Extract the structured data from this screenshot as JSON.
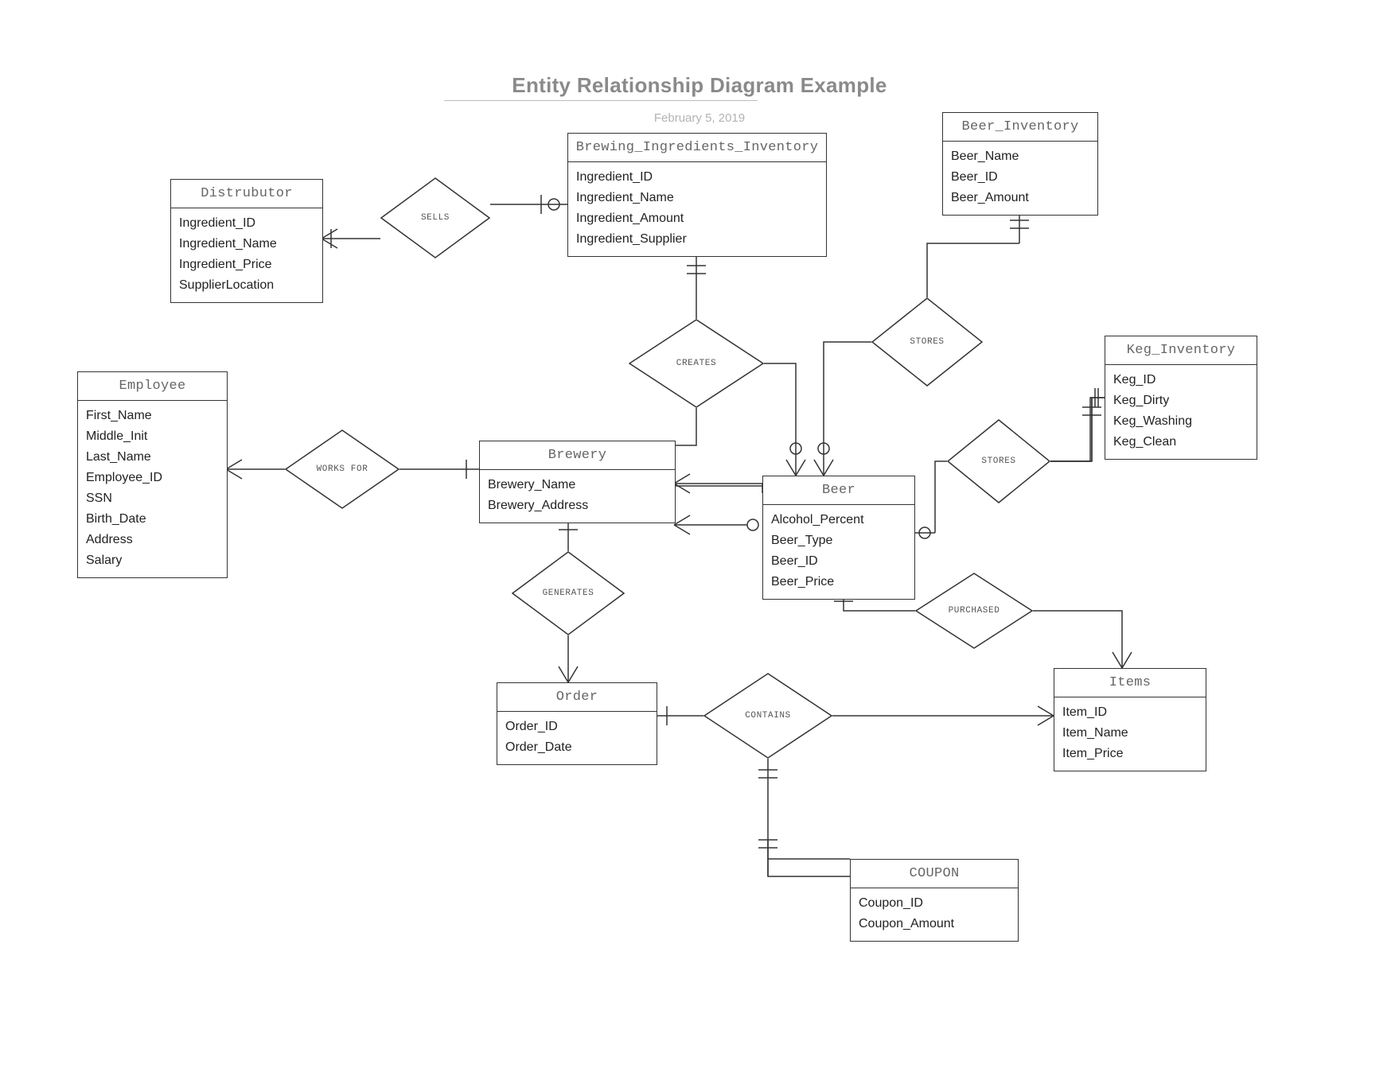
{
  "title": "Entity Relationship Diagram Example",
  "subtitle": "February 5, 2019",
  "entities": {
    "distributor": {
      "name": "Distrubutor",
      "attrs": [
        "Ingredient_ID",
        "Ingredient_Name",
        "Ingredient_Price",
        "SupplierLocation"
      ]
    },
    "brewing_inv": {
      "name": "Brewing_Ingredients_Inventory",
      "attrs": [
        "Ingredient_ID",
        "Ingredient_Name",
        "Ingredient_Amount",
        "Ingredient_Supplier"
      ]
    },
    "beer_inv": {
      "name": "Beer_Inventory",
      "attrs": [
        "Beer_Name",
        "Beer_ID",
        "Beer_Amount"
      ]
    },
    "employee": {
      "name": "Employee",
      "attrs": [
        "First_Name",
        "Middle_Init",
        "Last_Name",
        "Employee_ID",
        "SSN",
        "Birth_Date",
        "Address",
        "Salary"
      ]
    },
    "brewery": {
      "name": "Brewery",
      "attrs": [
        "Brewery_Name",
        "Brewery_Address"
      ]
    },
    "keg_inv": {
      "name": "Keg_Inventory",
      "attrs": [
        "Keg_ID",
        "Keg_Dirty",
        "Keg_Washing",
        "Keg_Clean"
      ]
    },
    "beer": {
      "name": "Beer",
      "attrs": [
        "Alcohol_Percent",
        "Beer_Type",
        "Beer_ID",
        "Beer_Price"
      ]
    },
    "order": {
      "name": "Order",
      "attrs": [
        "Order_ID",
        "Order_Date"
      ]
    },
    "items": {
      "name": "Items",
      "attrs": [
        "Item_ID",
        "Item_Name",
        "Item_Price"
      ]
    },
    "coupon": {
      "name": "COUPON",
      "attrs": [
        "Coupon_ID",
        "Coupon_Amount"
      ]
    }
  },
  "relationships": {
    "sells": {
      "label": "SELLS"
    },
    "creates": {
      "label": "CREATES"
    },
    "stores1": {
      "label": "STORES"
    },
    "stores2": {
      "label": "STORES"
    },
    "worksfor": {
      "label": "WORKS FOR"
    },
    "generates": {
      "label": "GENERATES"
    },
    "purchased": {
      "label": "PURCHASED"
    },
    "contains": {
      "label": "CONTAINS"
    }
  }
}
